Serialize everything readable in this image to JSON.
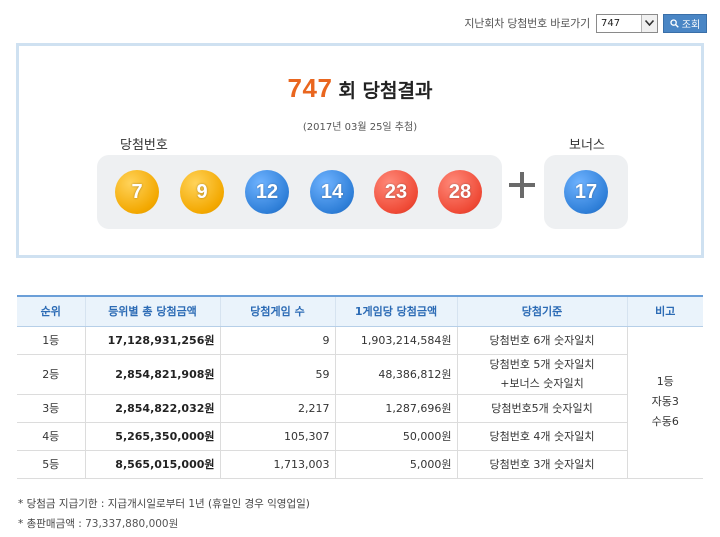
{
  "nav": {
    "label": "지난회차 당첨번호 바로가기",
    "selected_round": "747",
    "search_button": "조회"
  },
  "result": {
    "round_number": "747",
    "round_suffix": "회 당첨결과",
    "draw_date": "(2017년 03월 25일 추첨)",
    "main_label": "당첨번호",
    "bonus_label": "보너스",
    "numbers": [
      "7",
      "9",
      "12",
      "14",
      "23",
      "28"
    ],
    "bonus_number": "17",
    "ball_colors": {
      "yellow": "#f3a800",
      "blue": "#2f7fd8",
      "red": "#ef4a36"
    }
  },
  "table": {
    "headers": [
      "순위",
      "등위별 총 당첨금액",
      "당첨게임 수",
      "1게임당 당첨금액",
      "당첨기준",
      "비고"
    ],
    "rows": [
      {
        "rank": "1등",
        "total": "17,128,931,256원",
        "winners": "9",
        "per_game": "1,903,214,584원",
        "criteria": "당첨번호 6개 숫자일치",
        "criteria2": ""
      },
      {
        "rank": "2등",
        "total": "2,854,821,908원",
        "winners": "59",
        "per_game": "48,386,812원",
        "criteria": "당첨번호 5개 숫자일치",
        "criteria2": "+보너스 숫자일치"
      },
      {
        "rank": "3등",
        "total": "2,854,822,032원",
        "winners": "2,217",
        "per_game": "1,287,696원",
        "criteria": "당첨번호5개 숫자일치",
        "criteria2": ""
      },
      {
        "rank": "4등",
        "total": "5,265,350,000원",
        "winners": "105,307",
        "per_game": "50,000원",
        "criteria": "당첨번호 4개 숫자일치",
        "criteria2": ""
      },
      {
        "rank": "5등",
        "total": "8,565,015,000원",
        "winners": "1,713,003",
        "per_game": "5,000원",
        "criteria": "당첨번호 3개 숫자일치",
        "criteria2": ""
      }
    ],
    "note": [
      "1등",
      "자동3",
      "수동6"
    ]
  },
  "footer": {
    "line1": "* 당첨금 지급기한 : 지급개시일로부터 1년 (휴일인 경우 익영업일)",
    "line2_label": "* 총판매금액 : ",
    "line2_value": "73,337,880,000원"
  }
}
